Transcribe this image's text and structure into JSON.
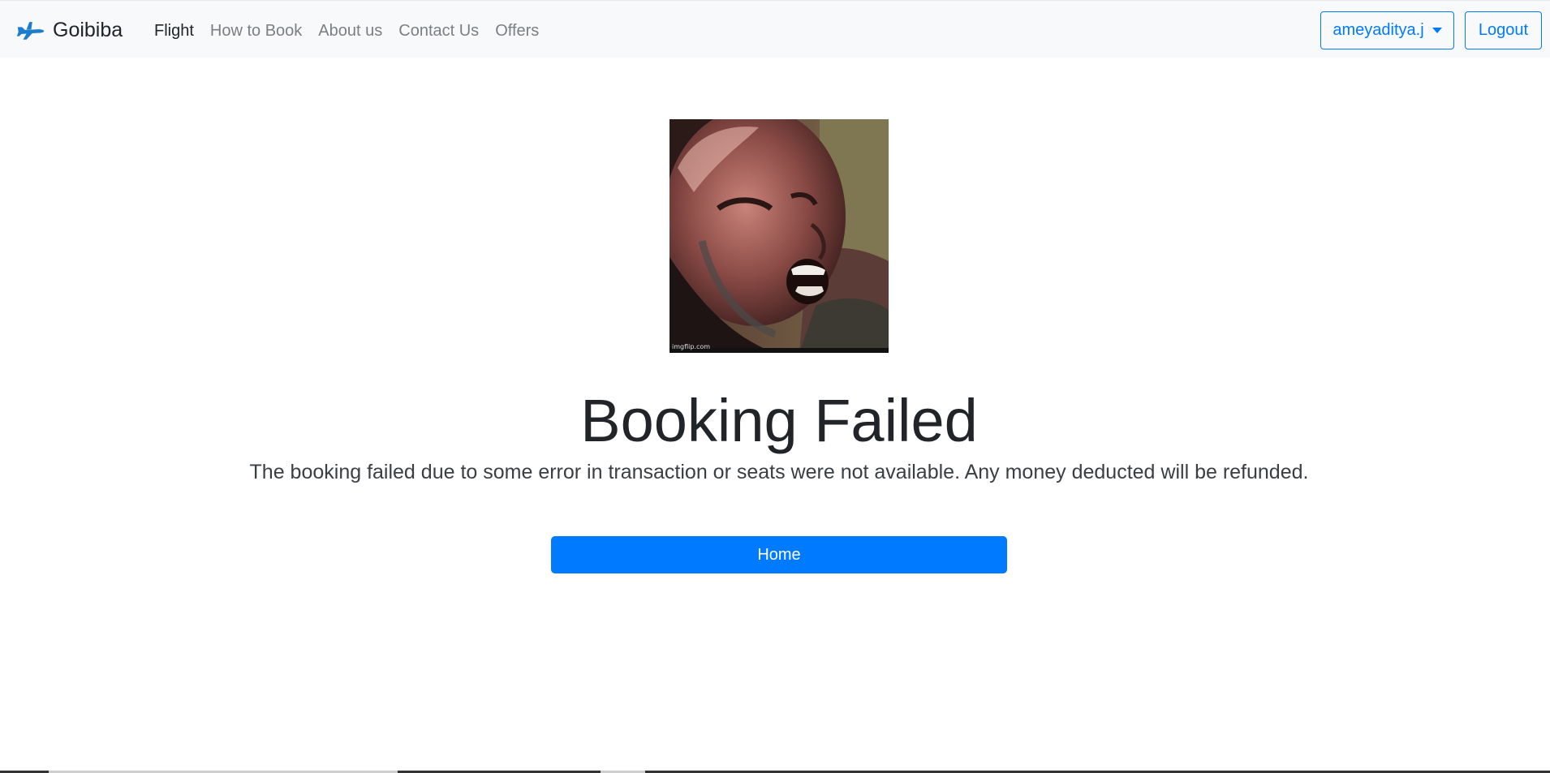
{
  "navbar": {
    "brand_name": "Goibiba",
    "brand_icon": "airplane-icon",
    "links": [
      {
        "label": "Flight",
        "active": true
      },
      {
        "label": "How to Book",
        "active": false
      },
      {
        "label": "About us",
        "active": false
      },
      {
        "label": "Contact Us",
        "active": false
      },
      {
        "label": "Offers",
        "active": false
      }
    ],
    "user_menu_label": "ameyaditya.j",
    "logout_label": "Logout"
  },
  "main": {
    "image_alt": "crying man gif",
    "image_watermark": "imgflip.com",
    "title": "Booking Failed",
    "message": "The booking failed due to some error in transaction or seats were not available. Any money deducted will be refunded.",
    "home_button_label": "Home"
  },
  "colors": {
    "primary": "#007bff",
    "navbar_bg": "#f8f9fa"
  }
}
